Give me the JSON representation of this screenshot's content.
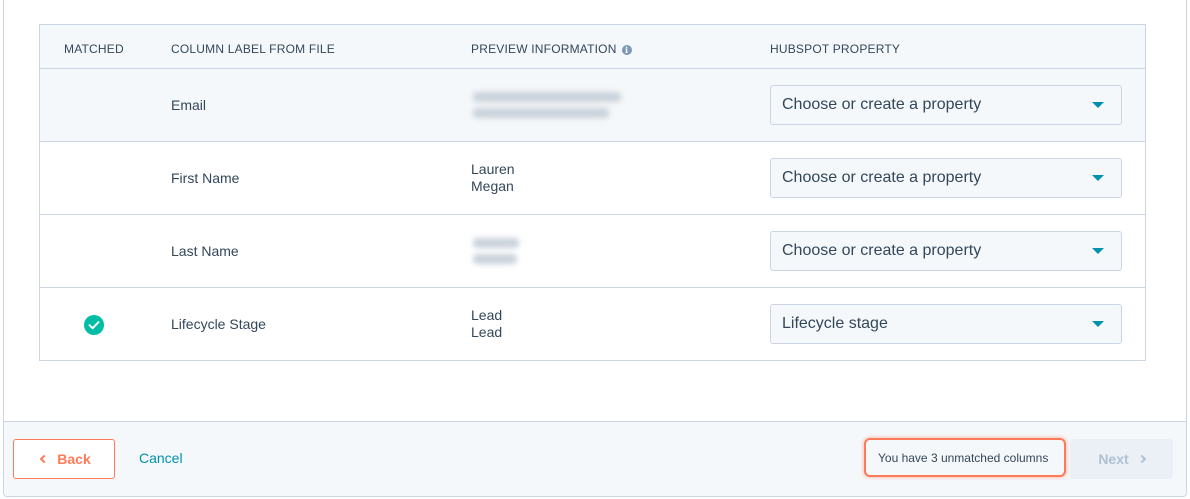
{
  "table": {
    "headers": {
      "matched": "MATCHED",
      "column_label": "COLUMN LABEL FROM FILE",
      "preview": "PREVIEW INFORMATION",
      "property": "HUBSPOT PROPERTY"
    },
    "rows": [
      {
        "label": "Email",
        "preview": [],
        "property": "Choose or create a property",
        "matched": false
      },
      {
        "label": "First Name",
        "preview": [
          "Lauren",
          "Megan"
        ],
        "property": "Choose or create a property",
        "matched": false
      },
      {
        "label": "Last Name",
        "preview": [],
        "property": "Choose or create a property",
        "matched": false
      },
      {
        "label": "Lifecycle Stage",
        "preview": [
          "Lead",
          "Lead"
        ],
        "property": "Lifecycle stage",
        "matched": true
      }
    ]
  },
  "footer": {
    "back_label": "Back",
    "cancel_label": "Cancel",
    "unmatched_text": "You have 3 unmatched columns",
    "next_label": "Next"
  },
  "icons": {
    "info": "info-icon",
    "check": "check-circle-icon",
    "caret": "caret-down-icon",
    "back": "chevron-left-icon",
    "next": "chevron-right-icon"
  },
  "colors": {
    "accent_orange": "#ff7a59",
    "link_blue": "#0091ae",
    "success_green": "#00bda5",
    "text": "#33475b",
    "border": "#cbd6e2"
  }
}
